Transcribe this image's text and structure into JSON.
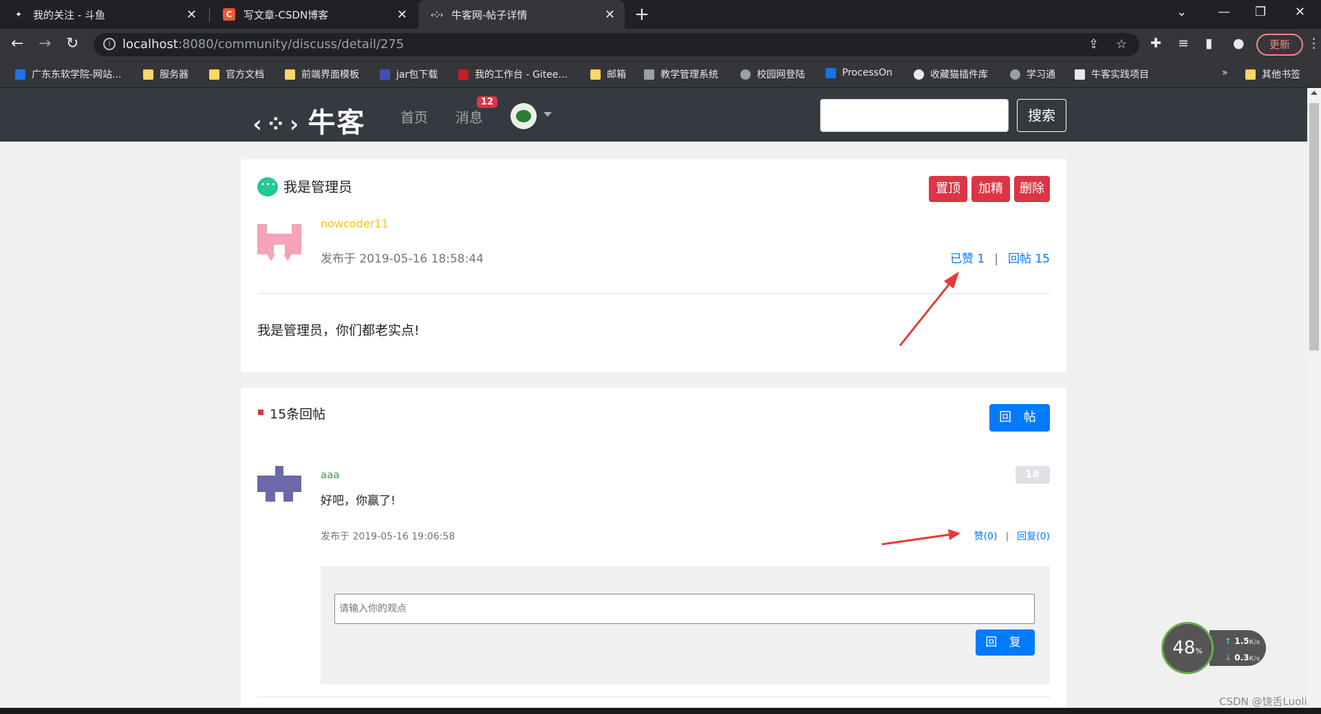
{
  "browser": {
    "tabs": [
      {
        "title": "我的关注 - 斗鱼",
        "favicon_color": "#ffffff"
      },
      {
        "title": "写文章-CSDN博客",
        "favicon_color": "#fc5531"
      },
      {
        "title": "牛客网-帖子详情",
        "favicon_color": "#e8eaed"
      }
    ],
    "new_tab": "+",
    "url_host": "localhost",
    "url_path": ":8080/community/discuss/detail/275",
    "update_label": "更新",
    "bookmarks": [
      {
        "label": "广东东软学院-网站...",
        "color": "#1a73e8"
      },
      {
        "label": "服务器",
        "color": "#fdd663"
      },
      {
        "label": "官方文档",
        "color": "#fdd663"
      },
      {
        "label": "前端界面模板",
        "color": "#fdd663"
      },
      {
        "label": "jar包下载",
        "color": "#3f51b5"
      },
      {
        "label": "我的工作台 - Gitee...",
        "color": "#c71d23"
      },
      {
        "label": "邮箱",
        "color": "#fdd663"
      },
      {
        "label": "教学管理系统",
        "color": "#9aa0a6"
      },
      {
        "label": "校园网登陆",
        "color": "#9aa0a6"
      },
      {
        "label": "ProcessOn",
        "color": "#1a73e8"
      },
      {
        "label": "收藏猫插件库",
        "color": "#e8eaed"
      },
      {
        "label": "学习通",
        "color": "#9aa0a6"
      },
      {
        "label": "牛客实践项目",
        "color": "#e8eaed"
      }
    ],
    "bookmarks_more": "»",
    "other_bookmarks": "其他书签"
  },
  "header": {
    "logo_text": "牛客",
    "nav": {
      "home": "首页",
      "messages": "消息"
    },
    "message_count": "12",
    "search_button": "搜索"
  },
  "post": {
    "title": "我是管理员",
    "actions": {
      "top": "置顶",
      "wonderful": "加精",
      "delete": "删除"
    },
    "author": "nowcoder11",
    "published": "发布于 2019-05-16 18:58:44",
    "like_status": "已赞 1",
    "reply_count": "回帖 15",
    "content": "我是管理员，你们都老实点!"
  },
  "comments": {
    "count_label": "15条回帖",
    "reply_post_button": "回 帖",
    "items": [
      {
        "user": "aaa",
        "floor": "1#",
        "content": "好吧，你赢了!",
        "published": "发布于 2019-05-16 19:06:58",
        "like": "赞(0)",
        "reply": "回复(0)"
      }
    ],
    "reply_placeholder": "请输入你的观点",
    "reply_button": "回 复"
  },
  "speed_widget": {
    "percent": "48",
    "percent_unit": "%",
    "up": "1.5",
    "down": "0.3",
    "unit": "K/s"
  },
  "watermark": "CSDN @饶舌Luoli",
  "colors": {
    "accent": "#007bff",
    "danger": "#dc3545",
    "header_bg": "#343a40",
    "annotation": "#e53935"
  }
}
